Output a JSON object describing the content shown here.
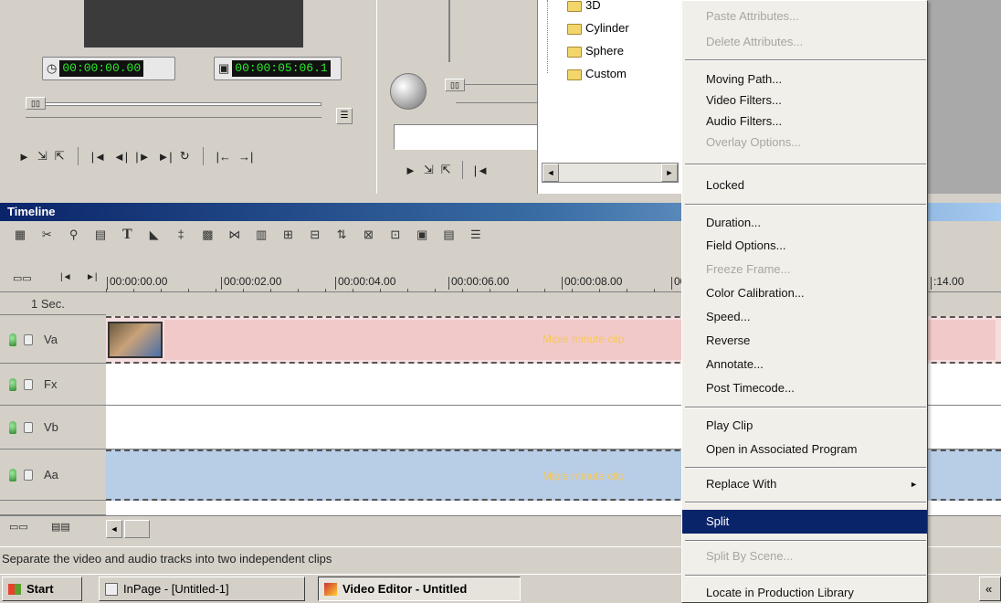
{
  "player": {
    "tc_start": "00:00:00.00",
    "tc_duration": "00:00:05:06.1"
  },
  "folders": [
    "3D",
    "Cylinder",
    "Sphere",
    "Custom"
  ],
  "timeline": {
    "title": "Timeline",
    "zoom": "1 Sec.",
    "ruler_marks": [
      "00:00:00.00",
      "00:00:02.00",
      "00:00:04.00",
      "00:00:06.00",
      "00:00:08.00",
      "00",
      ":14.00"
    ],
    "tracks": [
      {
        "label": "Va"
      },
      {
        "label": "Fx"
      },
      {
        "label": "Vb"
      },
      {
        "label": "Aa"
      }
    ],
    "clip_caption": "Miple minute clip"
  },
  "context_menu": {
    "items": [
      {
        "label": "Paste Attributes...",
        "enabled": false
      },
      {
        "label": "Delete Attributes...",
        "enabled": false
      },
      {
        "label": "Moving Path...",
        "enabled": true
      },
      {
        "label": "Video Filters...",
        "enabled": true
      },
      {
        "label": "Audio Filters...",
        "enabled": true
      },
      {
        "label": "Overlay Options...",
        "enabled": false
      },
      {
        "label": "Locked",
        "enabled": true
      },
      {
        "label": "Duration...",
        "enabled": true
      },
      {
        "label": "Field Options...",
        "enabled": true
      },
      {
        "label": "Freeze Frame...",
        "enabled": false
      },
      {
        "label": "Color Calibration...",
        "enabled": true
      },
      {
        "label": "Speed...",
        "enabled": true
      },
      {
        "label": "Reverse",
        "enabled": true
      },
      {
        "label": "Annotate...",
        "enabled": true
      },
      {
        "label": "Post Timecode...",
        "enabled": true
      },
      {
        "label": "Play Clip",
        "enabled": true
      },
      {
        "label": "Open in Associated Program",
        "enabled": true
      },
      {
        "label": "Replace With",
        "enabled": true
      },
      {
        "label": "Split",
        "enabled": true
      },
      {
        "label": "Split By Scene...",
        "enabled": false
      },
      {
        "label": "Locate in Production Library",
        "enabled": true
      }
    ]
  },
  "status_bar": {
    "text": "Separate the video and audio tracks into two independent clips"
  },
  "taskbar": {
    "start": "Start",
    "tasks": [
      "InPage - [Untitled-1]",
      "Video Editor - Untitled"
    ],
    "overflow": "«"
  },
  "colors": {
    "menu_highlight": "#0a246a",
    "title_bar": "#0a246a",
    "video_track": "#f2c9c9",
    "audio_track": "#b8cde6",
    "timecode_green": "#2ee82e"
  }
}
